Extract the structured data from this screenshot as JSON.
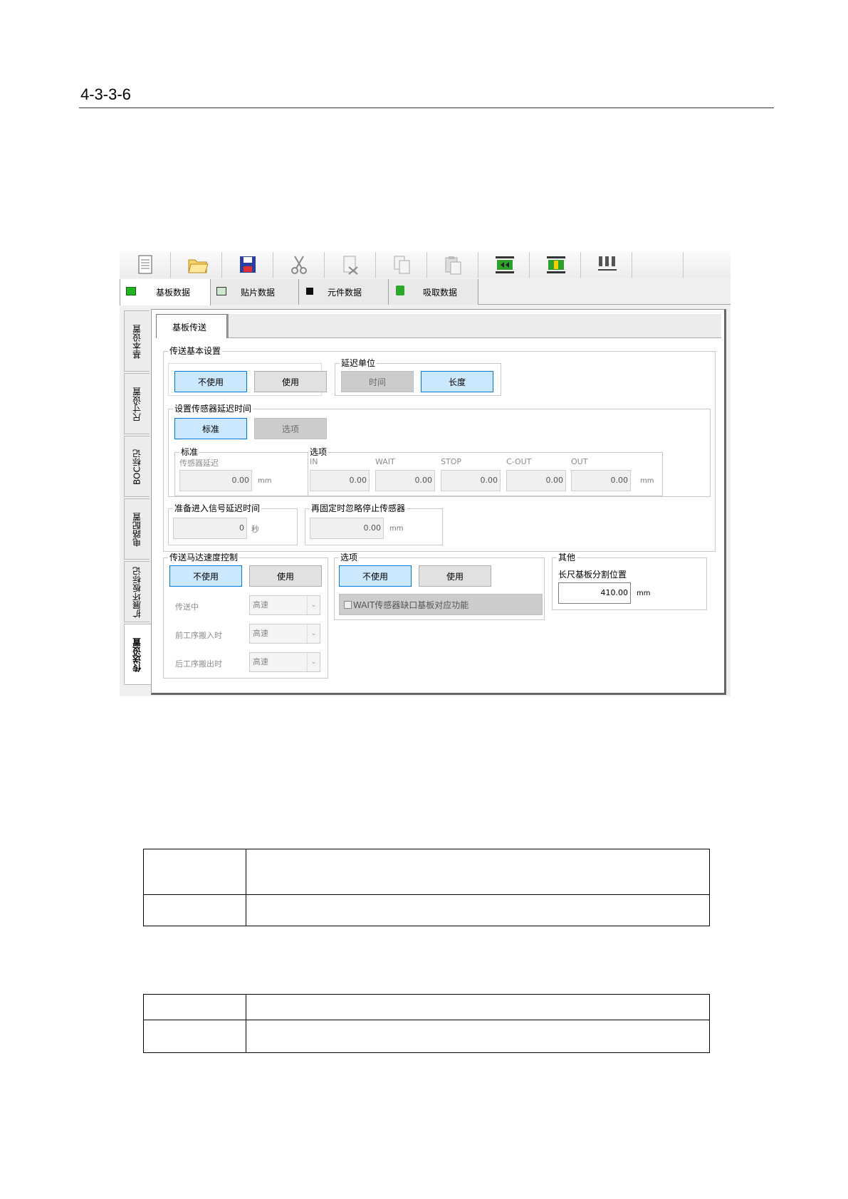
{
  "heading": "4-3-3-6",
  "toolbar": {
    "icons": [
      "new-file-icon",
      "open-folder-icon",
      "save-icon",
      "cut-icon",
      "delete-icon",
      "copy-icon",
      "paste-icon",
      "board-left-icon",
      "board-center-icon",
      "nozzle-icon"
    ]
  },
  "top_tabs": [
    {
      "label": "基板数据"
    },
    {
      "label": "贴片数据"
    },
    {
      "label": "元件数据"
    },
    {
      "label": "吸取数据"
    }
  ],
  "side_tabs": [
    {
      "label": "基本设置"
    },
    {
      "label": "尺寸设置"
    },
    {
      "label": "BOC标记"
    },
    {
      "label": "电路配置"
    },
    {
      "label": "扩展坏板标记"
    },
    {
      "label": "传送设置"
    }
  ],
  "subtab": "基板传送",
  "basic": {
    "title": "传送基本设置",
    "btn_off": "不使用",
    "btn_on": "使用"
  },
  "delay_unit": {
    "title": "延迟单位",
    "time": "时间",
    "length": "长度"
  },
  "sensor_delay": {
    "title": "设置传感器延迟时间",
    "standard": "标准",
    "option": "选项",
    "std_group": "标准",
    "std_label": "传感器延迟",
    "std_value": "0.00",
    "std_unit": "mm",
    "opt_group": "选项",
    "opt_cols": [
      {
        "label": "IN",
        "value": "0.00"
      },
      {
        "label": "WAIT",
        "value": "0.00"
      },
      {
        "label": "STOP",
        "value": "0.00"
      },
      {
        "label": "C-OUT",
        "value": "0.00"
      },
      {
        "label": "OUT",
        "value": "0.00"
      }
    ],
    "opt_unit": "mm"
  },
  "ready_delay": {
    "title": "准备进入信号延迟时间",
    "value": "0",
    "unit": "秒"
  },
  "refix": {
    "title": "再固定时忽略停止传感器",
    "value": "0.00",
    "unit": "mm"
  },
  "motor": {
    "title": "传送马达速度控制",
    "btn_off": "不使用",
    "btn_on": "使用",
    "rows": [
      {
        "label": "传送中",
        "value": "高速"
      },
      {
        "label": "前工序搬入时",
        "value": "高速"
      },
      {
        "label": "后工序搬出时",
        "value": "高速"
      }
    ]
  },
  "options": {
    "title": "选项",
    "btn_off": "不使用",
    "btn_on": "使用",
    "checkbox": "WAIT传感器缺口基板对应功能"
  },
  "other": {
    "title": "其他",
    "label": "长尺基板分割位置",
    "value": "410.00",
    "unit": "mm"
  }
}
